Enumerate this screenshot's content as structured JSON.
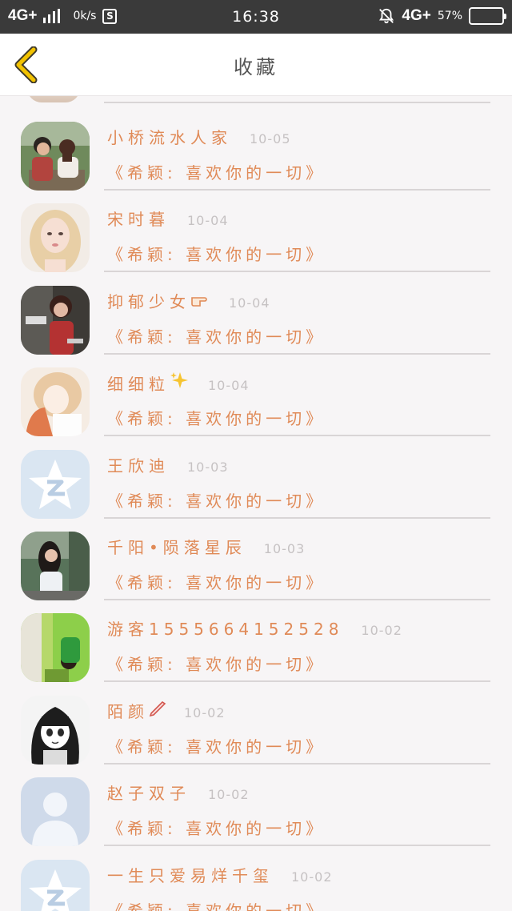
{
  "status_bar": {
    "network": "4G+",
    "speed": "0k/s",
    "s_badge": "S",
    "time": "16:38",
    "network_right": "4G+",
    "battery_percent": "57%",
    "battery_level": 0.57
  },
  "nav": {
    "title": "收藏",
    "back_icon": "chevron-left-icon",
    "accent_color": "#f2c200"
  },
  "colors": {
    "name": "#e08a57",
    "date": "#c6c2c3",
    "divider": "#d9d5d6"
  },
  "items": [
    {
      "name": "小桥流水人家",
      "date": "10-05",
      "title": "《希颖: 喜欢你的一切》",
      "avatar": "couple-photo"
    },
    {
      "name": "宋时暮",
      "date": "10-04",
      "title": "《希颖: 喜欢你的一切》",
      "avatar": "blonde-girl-photo"
    },
    {
      "name": "抑郁少女",
      "name_icon": "pointing-hand-icon",
      "date": "10-04",
      "title": "《希颖: 喜欢你的一切》",
      "avatar": "girl-phone-photo"
    },
    {
      "name": "细细粒",
      "name_icon": "sparkles-icon",
      "date": "10-04",
      "title": "《希颖: 喜欢你的一切》",
      "avatar": "anime-girl-photo"
    },
    {
      "name": "王欣迪",
      "date": "10-03",
      "title": "《希颖: 喜欢你的一切》",
      "avatar": "qzone-star-icon"
    },
    {
      "name": "千阳•陨落星辰",
      "date": "10-03",
      "title": "《希颖: 喜欢你的一切》",
      "avatar": "girl-street-photo"
    },
    {
      "name": "游客1555664152528",
      "date": "10-02",
      "title": "《希颖: 喜欢你的一切》",
      "avatar": "green-outdoor-photo"
    },
    {
      "name": "陌颜",
      "name_icon": "pen-icon",
      "date": "10-02",
      "title": "《希颖: 喜欢你的一切》",
      "avatar": "manga-girl-sketch"
    },
    {
      "name": "赵子双子",
      "date": "10-02",
      "title": "《希颖: 喜欢你的一切》",
      "avatar": "default-person-icon"
    },
    {
      "name": "一生只爱易烊千玺",
      "date": "10-02",
      "title": "《希颖: 喜欢你的一切》",
      "avatar": "qzone-star-icon"
    }
  ]
}
